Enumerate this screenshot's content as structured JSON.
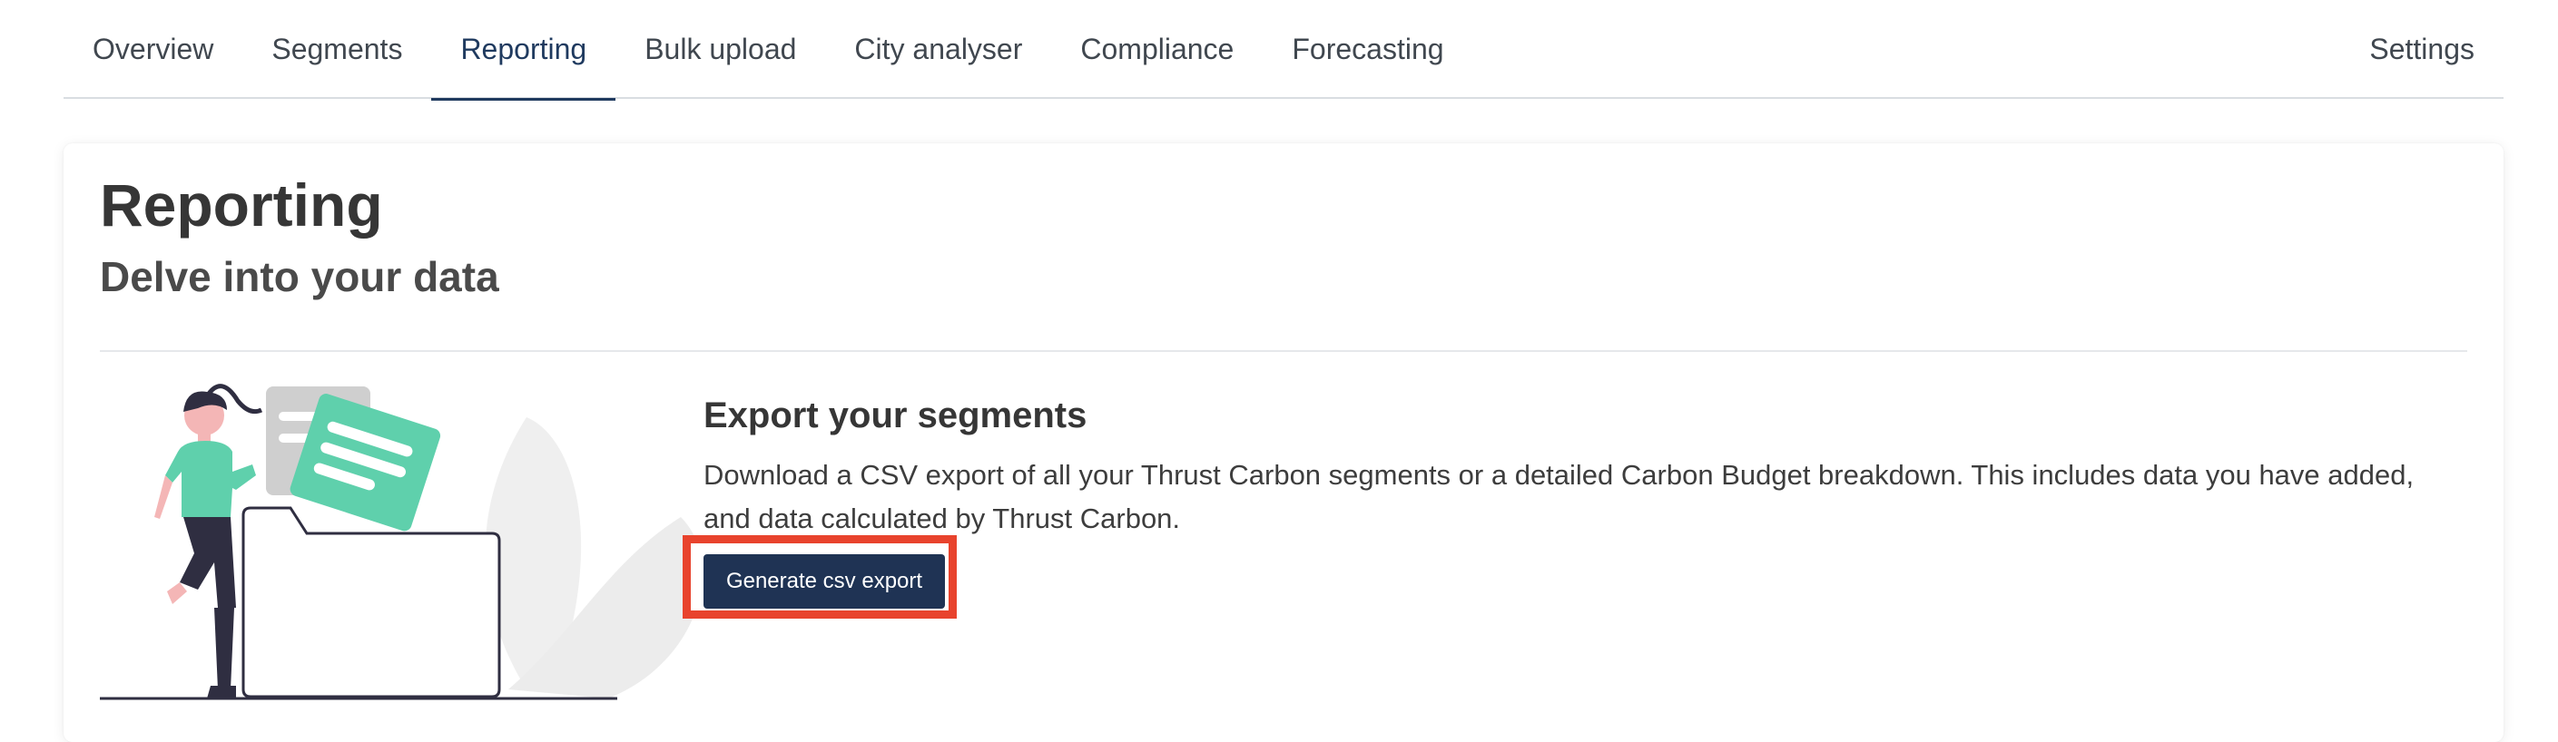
{
  "nav": {
    "tabs": [
      {
        "label": "Overview"
      },
      {
        "label": "Segments"
      },
      {
        "label": "Reporting",
        "active": true
      },
      {
        "label": "Bulk upload"
      },
      {
        "label": "City analyser"
      },
      {
        "label": "Compliance"
      },
      {
        "label": "Forecasting"
      }
    ],
    "settings_label": "Settings"
  },
  "page": {
    "title": "Reporting",
    "subtitle": "Delve into your data"
  },
  "export": {
    "title": "Export your segments",
    "description": "Download a CSV export of all your Thrust Carbon segments or a detailed Carbon Budget breakdown. This includes data you have added, and data calculated by Thrust Carbon.",
    "button_label": "Generate csv export"
  },
  "colors": {
    "active_tab": "#1f3a5f",
    "button_bg": "#1f3354",
    "highlight_border": "#e8432d",
    "illustration_accent": "#5fd0ac"
  },
  "icons": [
    "person-with-folder-illustration"
  ]
}
